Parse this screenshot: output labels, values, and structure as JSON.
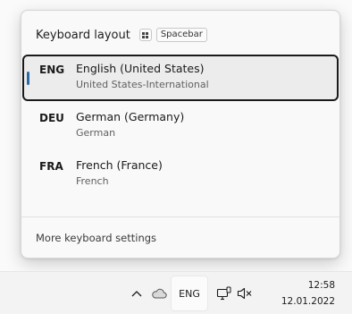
{
  "flyout": {
    "title": "Keyboard layout",
    "shortcut_key": "Spacebar",
    "layouts": [
      {
        "code": "ENG",
        "language": "English (United States)",
        "variant": "United States-International",
        "selected": true
      },
      {
        "code": "DEU",
        "language": "German (Germany)",
        "variant": "German",
        "selected": false
      },
      {
        "code": "FRA",
        "language": "French (France)",
        "variant": "French",
        "selected": false
      }
    ],
    "footer_link": "More keyboard settings"
  },
  "taskbar": {
    "icons": [
      "chevron-up-icon",
      "onedrive-cloud-icon",
      "network-icon",
      "volume-muted-icon"
    ],
    "input_indicator": "ENG",
    "time": "12:58",
    "date": "12.01.2022"
  },
  "colors": {
    "selection_accent": "#2a6aa8",
    "selection_border": "#1a1a1a"
  }
}
